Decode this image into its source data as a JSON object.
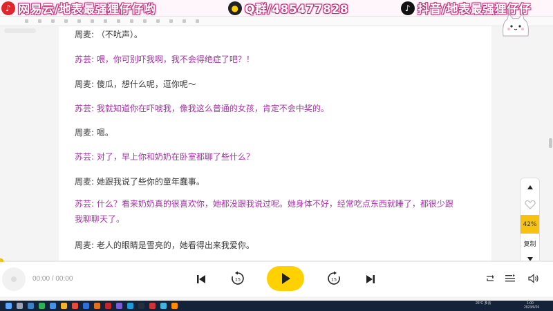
{
  "banner": {
    "netease": "网易云/地表最强狸仔仔哟",
    "qq": "Q群/485477828",
    "douyin": "抖音/地表最强狸仔仔"
  },
  "dialogue": [
    {
      "speaker": "周麦",
      "text": "周麦: （不吭声）。",
      "role": "male"
    },
    {
      "speaker": "苏芸",
      "text": "苏芸: 喂，你可别吓我啊，我不会得绝症了吧？！",
      "role": "female"
    },
    {
      "speaker": "周麦",
      "text": "周麦: 傻瓜，想什么呢，逗你呢～",
      "role": "male"
    },
    {
      "speaker": "苏芸",
      "text": "苏芸: 我就知道你在吓唬我，像我这么普通的女孩，肯定不会中奖的。",
      "role": "female"
    },
    {
      "speaker": "周麦",
      "text": "周麦: 嗯。",
      "role": "male"
    },
    {
      "speaker": "苏芸",
      "text": "苏芸: 对了，早上你和奶奶在卧室都聊了些什么？",
      "role": "female"
    },
    {
      "speaker": "周麦",
      "text": "周麦: 她跟我说了些你的童年蠢事。",
      "role": "male"
    },
    {
      "speaker": "苏芸",
      "text": "苏芸: 什么？看来奶奶真的很喜欢你，她都没跟我说过呢。她身体不好，经常吃点东西就睡了，都很少跟我聊聊天了。",
      "role": "female"
    },
    {
      "speaker": "周麦",
      "text": "周麦: 老人的眼睛是雪亮的，她看得出来我爱你。",
      "role": "male"
    }
  ],
  "tools": {
    "up_icon": "caret-up-icon",
    "like_icon": "heart-icon",
    "percent": "42%",
    "copy_label": "复制",
    "down_icon": "caret-down-icon"
  },
  "player": {
    "time": "00:00 / 00:00",
    "progress": 0,
    "skip_back": "15",
    "skip_forward": "15"
  },
  "taskbar": {
    "weather": "26°C 多云",
    "clock": "1:00",
    "date": "2023/6/26"
  },
  "colors": {
    "female_text": "#a634a6",
    "male_text": "#3a3a3a",
    "accent": "#ffd100",
    "banner_outline": "#c0307a"
  }
}
